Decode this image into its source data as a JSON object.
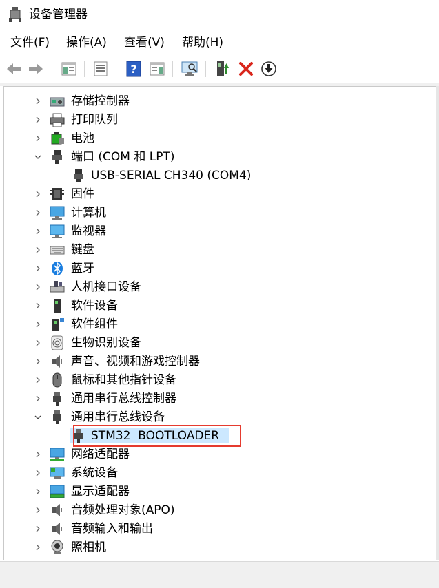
{
  "window": {
    "title": "设备管理器",
    "icon": "device-manager-icon"
  },
  "menu": [
    {
      "label": "文件(F)"
    },
    {
      "label": "操作(A)"
    },
    {
      "label": "查看(V)"
    },
    {
      "label": "帮助(H)"
    }
  ],
  "toolbar": {
    "buttons": [
      "back-arrow-icon",
      "forward-arrow-icon",
      "show-hide-tree-icon",
      "properties-icon",
      "help-icon",
      "action-pane-icon",
      "scan-hardware-icon",
      "update-driver-icon",
      "uninstall-icon",
      "disable-device-icon"
    ],
    "colors": {
      "uninstall": "#d9261c",
      "update": "#2e8b2e"
    }
  },
  "tree": {
    "items": [
      {
        "label": "存储控制器",
        "icon": "storage-controller-icon",
        "expanded": false
      },
      {
        "label": "打印队列",
        "icon": "printer-icon",
        "expanded": false
      },
      {
        "label": "电池",
        "icon": "battery-icon",
        "expanded": false
      },
      {
        "label": "端口 (COM 和 LPT)",
        "icon": "port-connector-icon",
        "expanded": true,
        "children": [
          {
            "label": "USB-SERIAL CH340 (COM4)",
            "icon": "port-connector-icon"
          }
        ]
      },
      {
        "label": "固件",
        "icon": "firmware-chip-icon",
        "expanded": false
      },
      {
        "label": "计算机",
        "icon": "computer-monitor-icon",
        "expanded": false
      },
      {
        "label": "监视器",
        "icon": "monitor-icon",
        "expanded": false
      },
      {
        "label": "键盘",
        "icon": "keyboard-icon",
        "expanded": false
      },
      {
        "label": "蓝牙",
        "icon": "bluetooth-icon",
        "expanded": false
      },
      {
        "label": "人机接口设备",
        "icon": "hid-icon",
        "expanded": false
      },
      {
        "label": "软件设备",
        "icon": "software-device-icon",
        "expanded": false
      },
      {
        "label": "软件组件",
        "icon": "software-component-icon",
        "expanded": false
      },
      {
        "label": "生物识别设备",
        "icon": "fingerprint-icon",
        "expanded": false
      },
      {
        "label": "声音、视频和游戏控制器",
        "icon": "speaker-icon",
        "expanded": false
      },
      {
        "label": "鼠标和其他指针设备",
        "icon": "mouse-icon",
        "expanded": false
      },
      {
        "label": "通用串行总线控制器",
        "icon": "usb-connector-icon",
        "expanded": false
      },
      {
        "label": "通用串行总线设备",
        "icon": "usb-connector-icon",
        "expanded": true,
        "children": [
          {
            "label": "STM32  BOOTLOADER",
            "icon": "usb-connector-icon",
            "selected": true
          }
        ]
      },
      {
        "label": "网络适配器",
        "icon": "network-adapter-icon",
        "expanded": false
      },
      {
        "label": "系统设备",
        "icon": "system-device-icon",
        "expanded": false
      },
      {
        "label": "显示适配器",
        "icon": "display-adapter-icon",
        "expanded": false
      },
      {
        "label": "音频处理对象(APO)",
        "icon": "speaker-icon",
        "expanded": false
      },
      {
        "label": "音频输入和输出",
        "icon": "speaker-icon",
        "expanded": false
      },
      {
        "label": "照相机",
        "icon": "camera-icon",
        "expanded": false
      }
    ]
  },
  "colors": {
    "selection": "#cce8ff",
    "highlight_box": "#e53b2f",
    "accent": "#0078d7"
  }
}
